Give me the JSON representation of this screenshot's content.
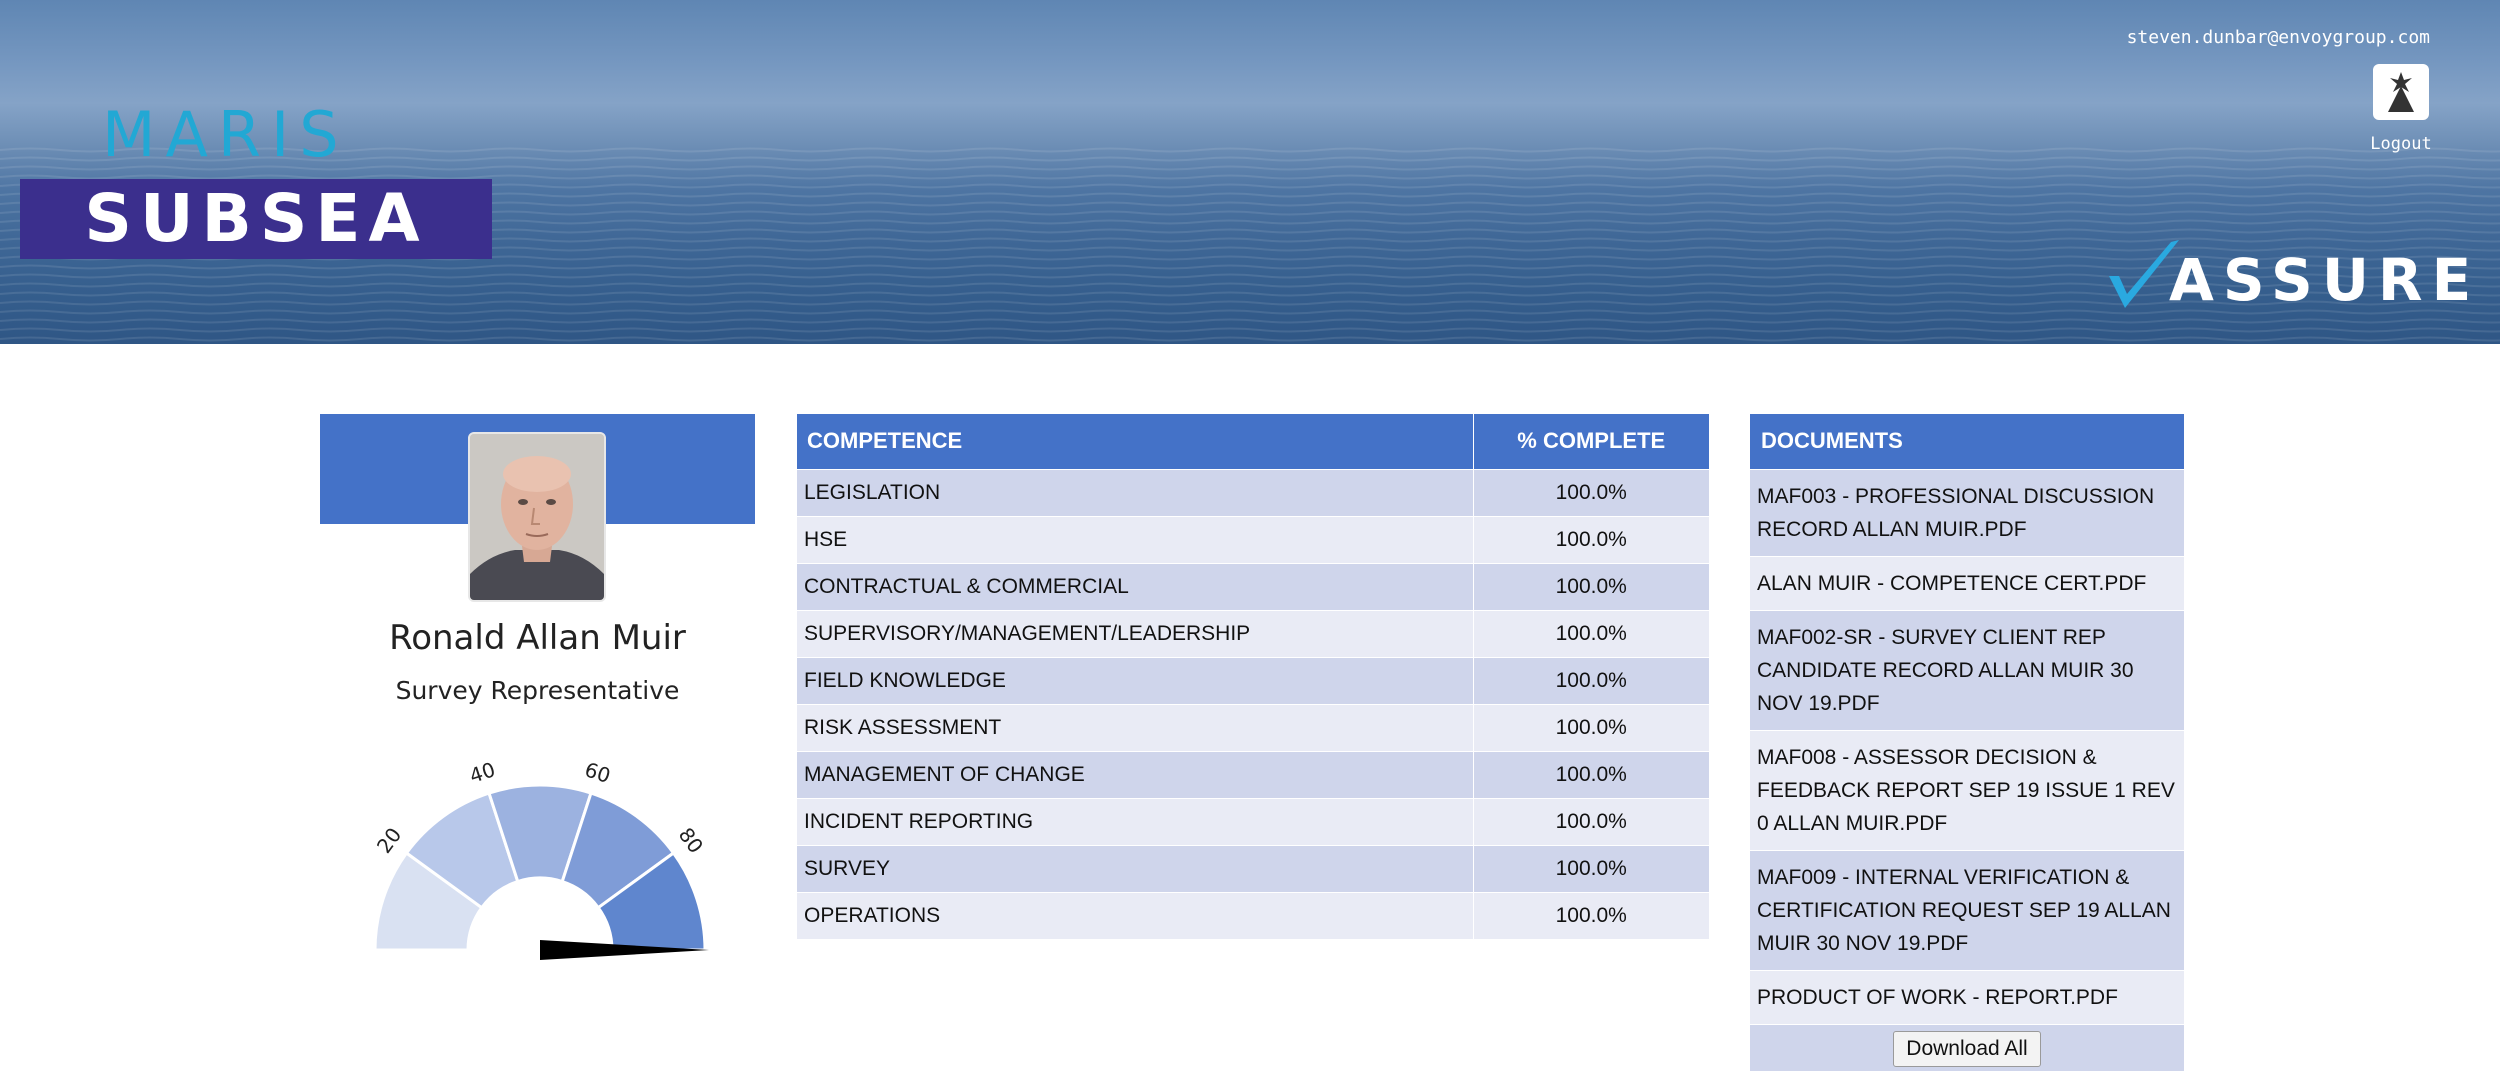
{
  "header": {
    "brand_top": "MARIS",
    "brand_bottom": "SUBSEA",
    "user_email": "steven.dunbar@envoygroup.com",
    "logout_label": "Logout",
    "product_logo": "ASSURE",
    "product_logo_check": "check-mark-icon"
  },
  "profile": {
    "name": "Ronald Allan Muir",
    "role": "Survey Representative",
    "photo_icon": "avatar-photo",
    "gauge": {
      "ticks": [
        "20",
        "40",
        "60",
        "80"
      ],
      "value_percent": 100,
      "segment_colors": [
        "#d9e1f2",
        "#b8c8ea",
        "#9cb2e0",
        "#7f9cd7",
        "#5f86ce"
      ]
    }
  },
  "competence": {
    "header_competence": "COMPETENCE",
    "header_complete": "% COMPLETE",
    "rows": [
      {
        "name": "LEGISLATION",
        "pct": "100.0%"
      },
      {
        "name": "HSE",
        "pct": "100.0%"
      },
      {
        "name": "CONTRACTUAL & COMMERCIAL",
        "pct": "100.0%"
      },
      {
        "name": "SUPERVISORY/MANAGEMENT/LEADERSHIP",
        "pct": "100.0%"
      },
      {
        "name": "FIELD KNOWLEDGE",
        "pct": "100.0%"
      },
      {
        "name": "RISK ASSESSMENT",
        "pct": "100.0%"
      },
      {
        "name": "MANAGEMENT OF CHANGE",
        "pct": "100.0%"
      },
      {
        "name": "INCIDENT REPORTING",
        "pct": "100.0%"
      },
      {
        "name": "SURVEY",
        "pct": "100.0%"
      },
      {
        "name": "OPERATIONS",
        "pct": "100.0%"
      }
    ]
  },
  "documents": {
    "header": "DOCUMENTS",
    "items": [
      "MAF003 - PROFESSIONAL DISCUSSION RECORD ALLAN MUIR.PDF",
      "ALAN MUIR - COMPETENCE CERT.PDF",
      "MAF002-SR - SURVEY CLIENT REP CANDIDATE RECORD ALLAN MUIR 30 NOV 19.PDF",
      "MAF008 - ASSESSOR DECISION & FEEDBACK REPORT SEP 19 ISSUE 1 REV 0 ALLAN MUIR.PDF",
      "MAF009 - INTERNAL VERIFICATION & CERTIFICATION REQUEST SEP 19 ALLAN MUIR 30 NOV 19.PDF",
      "PRODUCT OF WORK - REPORT.PDF"
    ],
    "download_all_label": "Download All"
  },
  "colors": {
    "accent": "#4472c8",
    "row_odd": "#cfd5eb",
    "row_even": "#e9ebf5",
    "brand_purple": "#3b2f8d",
    "brand_cyan": "#22a8d4"
  }
}
